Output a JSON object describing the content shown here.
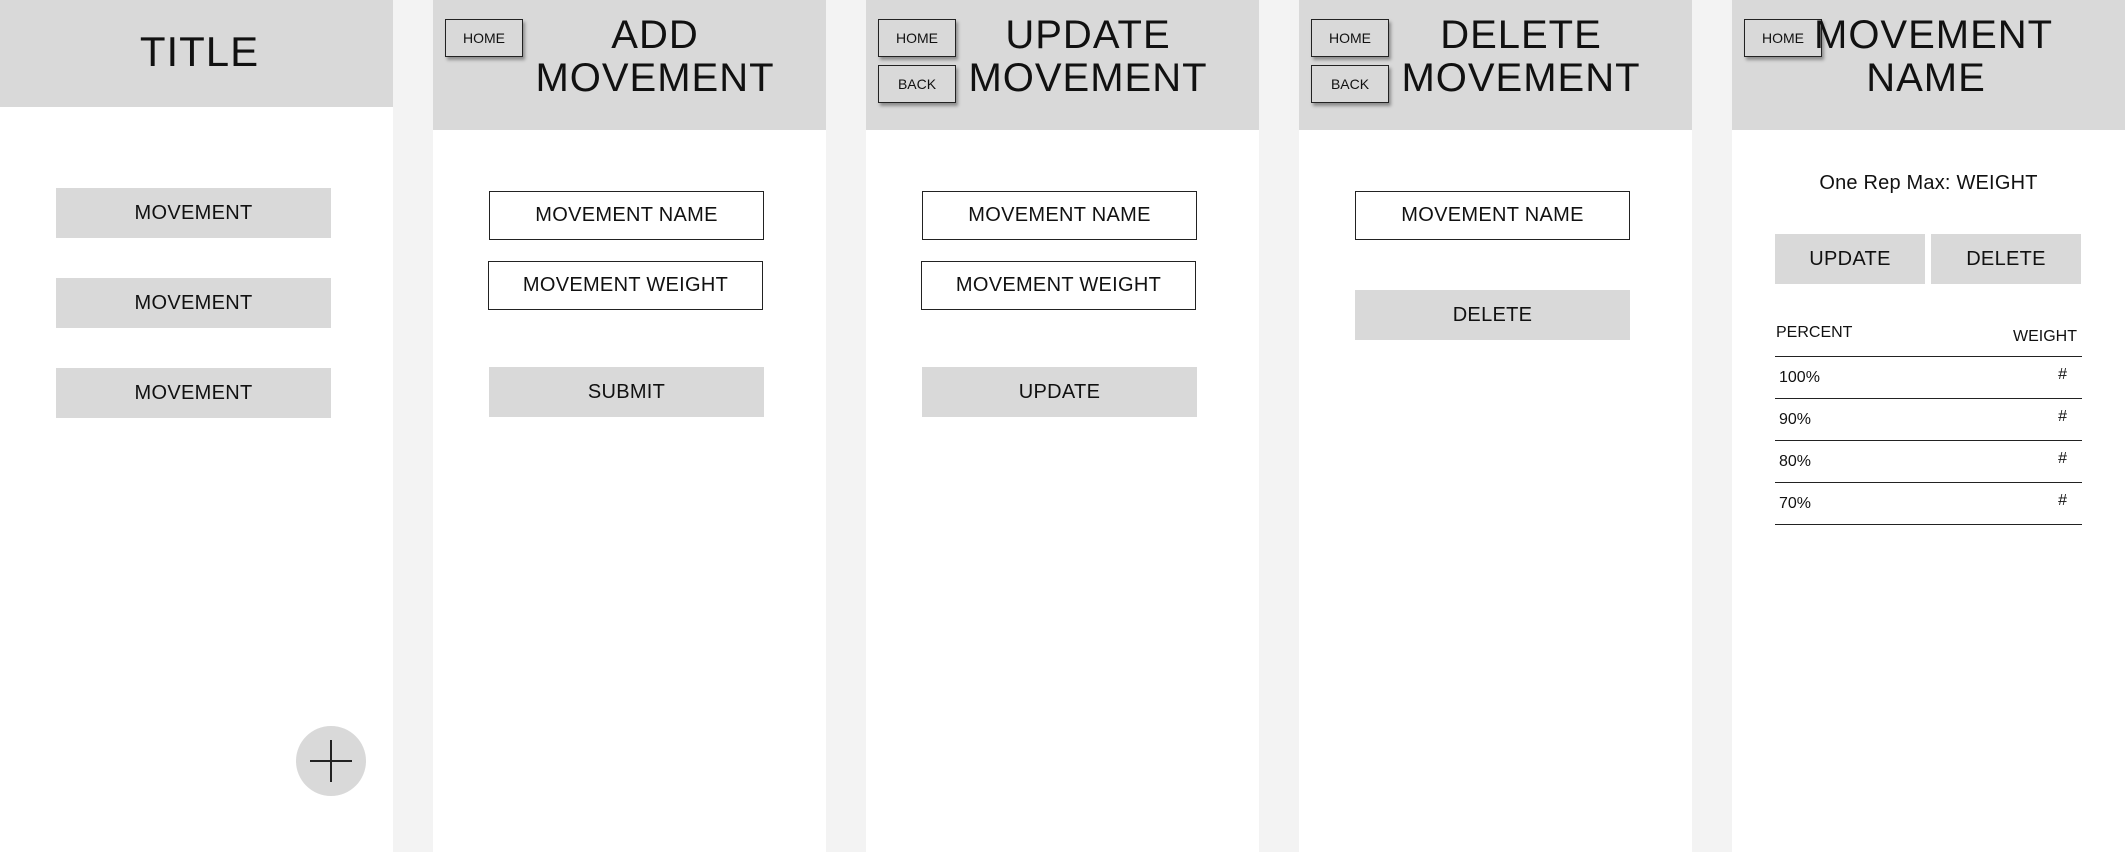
{
  "nav": {
    "home_label": "HOME",
    "back_label": "BACK"
  },
  "home_screen": {
    "title": "TITLE",
    "movements": [
      "MOVEMENT",
      "MOVEMENT",
      "MOVEMENT"
    ],
    "add_icon": "plus-icon"
  },
  "add_screen": {
    "title": "ADD\nMOVEMENT",
    "name_field": "MOVEMENT NAME",
    "weight_field": "MOVEMENT WEIGHT",
    "submit_label": "SUBMIT"
  },
  "update_screen": {
    "title": "UPDATE\nMOVEMENT",
    "name_field": "MOVEMENT NAME",
    "weight_field": "MOVEMENT WEIGHT",
    "update_label": "UPDATE"
  },
  "delete_screen": {
    "title": "DELETE\nMOVEMENT",
    "name_field": "MOVEMENT NAME",
    "delete_label": "DELETE"
  },
  "detail_screen": {
    "title": "MOVEMENT\nNAME",
    "one_rep_max": "One Rep Max: WEIGHT",
    "update_label": "UPDATE",
    "delete_label": "DELETE",
    "table": {
      "headers": [
        "PERCENT",
        "WEIGHT"
      ],
      "rows": [
        [
          "100%",
          "#"
        ],
        [
          "90%",
          "#"
        ],
        [
          "80%",
          "#"
        ],
        [
          "70%",
          "#"
        ]
      ]
    }
  },
  "colors": {
    "background": "#f3f3f3",
    "screen": "#ffffff",
    "gray_block": "#d9d9d9",
    "border": "#222222"
  }
}
